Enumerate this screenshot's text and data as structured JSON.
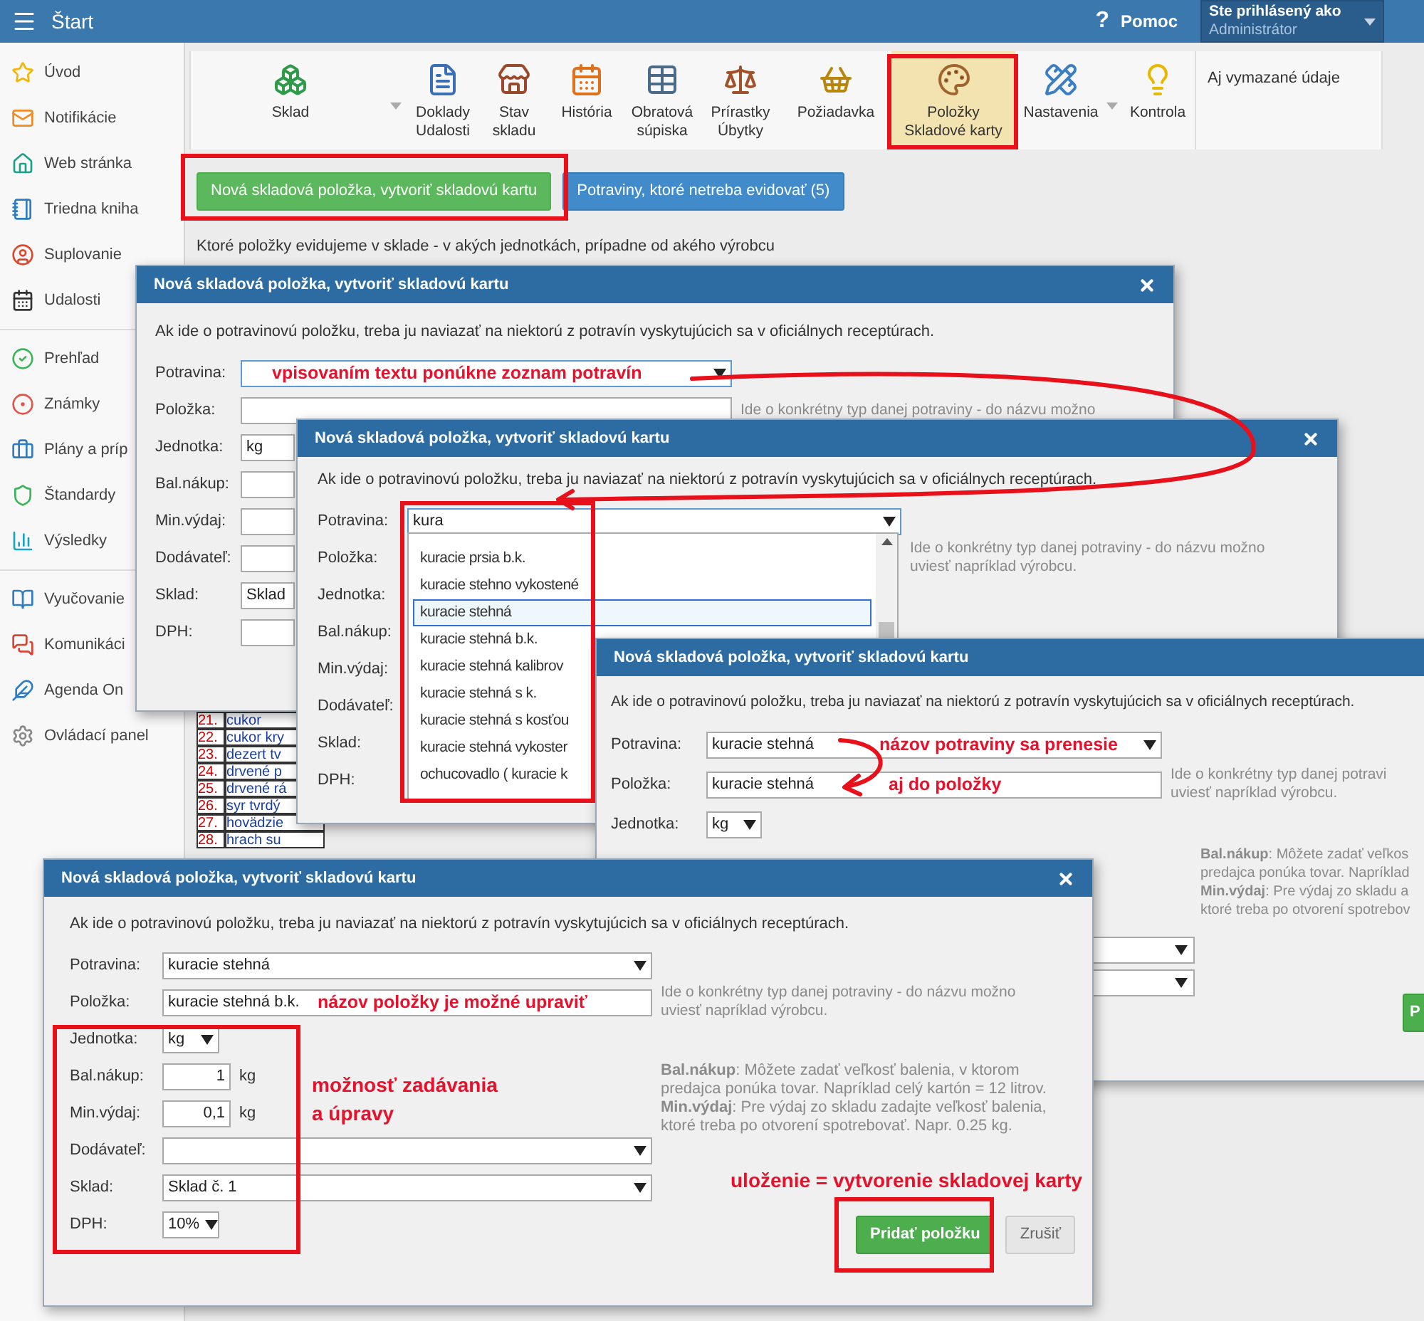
{
  "top_bar": {
    "title": "Štart",
    "help_symbol": "?",
    "help_label": "Pomoc",
    "user_caption": "Ste prihlásený ako",
    "user_name": "Administrátor"
  },
  "sidebar": {
    "sections": [
      {
        "items": [
          {
            "label": "Úvod"
          },
          {
            "label": "Notifikácie"
          },
          {
            "label": "Web stránka"
          },
          {
            "label": "Triedna kniha"
          },
          {
            "label": "Suplovanie"
          },
          {
            "label": "Udalosti"
          }
        ]
      },
      {
        "items": [
          {
            "label": "Prehľad"
          },
          {
            "label": "Známky"
          },
          {
            "label": "Plány a príp"
          },
          {
            "label": "Štandardy"
          },
          {
            "label": "Výsledky"
          }
        ]
      },
      {
        "items": [
          {
            "label": "Vyučovanie"
          },
          {
            "label": "Komunikáci"
          },
          {
            "label": "Agenda On"
          },
          {
            "label": "Ovládací panel"
          }
        ]
      }
    ]
  },
  "toolbar": {
    "items": [
      {
        "lines": [
          "Sklad"
        ],
        "menu": true,
        "selected": false
      },
      {
        "lines": [
          "Doklady",
          "Udalosti"
        ],
        "menu": false,
        "selected": false
      },
      {
        "lines": [
          "Stav",
          "skladu"
        ],
        "menu": false,
        "selected": false
      },
      {
        "lines": [
          "História"
        ],
        "menu": false,
        "selected": false
      },
      {
        "lines": [
          "Obratová",
          "súpiska"
        ],
        "menu": false,
        "selected": false
      },
      {
        "lines": [
          "Prírastky",
          "Úbytky"
        ],
        "menu": false,
        "selected": false
      },
      {
        "lines": [
          "Požiadavka"
        ],
        "menu": false,
        "selected": false
      },
      {
        "lines": [
          "Položky",
          "Skladové karty"
        ],
        "menu": false,
        "selected": true
      },
      {
        "lines": [
          "Nastavenia"
        ],
        "menu": true,
        "selected": false
      },
      {
        "lines": [
          "Kontrola"
        ],
        "menu": false,
        "selected": false
      }
    ],
    "deleted_toggle": "Aj vymazané údaje"
  },
  "actions": [
    {
      "label": "Nová skladová položka, vytvoriť skladovú kartu",
      "kind": "success"
    },
    {
      "label": "Potraviny, ktoré netreba evidovať (5)",
      "kind": "info"
    }
  ],
  "description": "Ktoré položky evidujeme v sklade - v akých jednotkách, prípadne od akého výrobcu",
  "background_list": [
    {
      "number": "21.",
      "name": "cukor"
    },
    {
      "number": "22.",
      "name": "cukor kry"
    },
    {
      "number": "23.",
      "name": "dezert tv"
    },
    {
      "number": "24.",
      "name": "drvené p"
    },
    {
      "number": "25.",
      "name": "drvené rá"
    },
    {
      "number": "26.",
      "name": "syr tvrdý"
    },
    {
      "number": "27.",
      "name": "hovädzie"
    },
    {
      "number": "28.",
      "name": "hrach su"
    }
  ],
  "dialogs": [
    {
      "title": "Nová skladová položka, vytvoriť skladovú kartu",
      "intro": "Ak ide o potravinovú položku, treba ju naviazať na niektorú z potravín vyskytujúcich sa v oficiálnych receptúrach.",
      "fields": [
        {
          "label": "Potravina:",
          "kind": "select",
          "focused": true,
          "annotation": "vpisovaním textu ponúkne zoznam potravín"
        },
        {
          "label": "Položka:",
          "kind": "input",
          "focused": false,
          "hint_lines": [
            "Ide o konkrétny typ danej potraviny - do názvu možno"
          ]
        },
        {
          "label": "Jednotka:",
          "kind": "input",
          "focused": false,
          "value": "kg"
        },
        {
          "label": "Bal.nákup:",
          "kind": "input",
          "focused": false
        },
        {
          "label": "Min.výdaj:",
          "kind": "input",
          "focused": false
        },
        {
          "label": "Dodávateľ:",
          "kind": "input",
          "focused": false
        },
        {
          "label": "Sklad:",
          "kind": "input",
          "focused": false,
          "value": "Sklad"
        },
        {
          "label": "DPH:",
          "kind": "input",
          "focused": false
        }
      ]
    },
    {
      "title": "Nová skladová položka, vytvoriť skladovú kartu",
      "intro": "Ak ide o potravinovú položku, treba ju naviazať na niektorú z potravín vyskytujúcich sa v oficiálnych receptúrach.",
      "fields": [
        {
          "label": "Potravina:",
          "kind": "select",
          "focused": true,
          "value": "kura"
        },
        {
          "label": "Položka:",
          "kind": "label",
          "hint_lines": [
            "Ide o konkrétny typ danej potraviny - do názvu možno",
            "uviesť napríklad výrobcu."
          ]
        },
        {
          "label": "Jednotka:",
          "kind": "label"
        },
        {
          "label": "Bal.nákup:",
          "kind": "label"
        },
        {
          "label": "Min.výdaj:",
          "kind": "label"
        },
        {
          "label": "Dodávateľ:",
          "kind": "label"
        },
        {
          "label": "Sklad:",
          "kind": "label"
        },
        {
          "label": "DPH:",
          "kind": "label"
        }
      ],
      "dropdown": [
        {
          "label": "kuracie prsia b.k.",
          "selected": false
        },
        {
          "label": "kuracie stehno vykostené",
          "selected": false
        },
        {
          "label": "kuracie stehná",
          "selected": true
        },
        {
          "label": "kuracie stehná b.k.",
          "selected": false
        },
        {
          "label": "kuracie stehná kalibrov",
          "selected": false
        },
        {
          "label": "kuracie stehná s k.",
          "selected": false
        },
        {
          "label": "kuracie stehná s kosťou",
          "selected": false
        },
        {
          "label": "kuracie stehná vykoster",
          "selected": false
        },
        {
          "label": "ochucovadlo ( kuracie k",
          "selected": false
        }
      ]
    },
    {
      "title": "Nová skladová položka, vytvoriť skladovú kartu",
      "intro": "Ak ide o potravinovú položku, treba ju naviazať na niektorú z potravín vyskytujúcich sa v oficiálnych receptúrach.",
      "fields": [
        {
          "label": "Potravina:",
          "kind": "select",
          "focused": false,
          "value": "kuracie stehná",
          "annotation": "názov potraviny sa prenesie"
        },
        {
          "label": "Položka:",
          "kind": "input",
          "focused": false,
          "value": "kuracie stehná",
          "annotation": "aj do položky",
          "hint_lines": [
            "Ide o konkrétny typ danej potravi",
            "uviesť napríklad výrobcu."
          ]
        },
        {
          "label": "Jednotka:",
          "kind": "small_select",
          "focused": false,
          "value": "kg"
        }
      ],
      "note_lines": [
        "**Bal.nákup**: Môžete zadať veľkos",
        "predajca ponúka tovar. Napríklad",
        "**Min.výdaj**: Pre výdaj zo skladu a",
        "ktoré treba po otvorení spotrebov"
      ],
      "buttons": [
        {
          "label": "P",
          "kind": "primary"
        }
      ]
    },
    {
      "title": "Nová skladová položka, vytvoriť skladovú kartu",
      "intro": "Ak ide o potravinovú položku, treba ju naviazať na niektorú z potravín vyskytujúcich sa v oficiálnych receptúrach.",
      "fields": [
        {
          "label": "Potravina:",
          "kind": "select",
          "focused": false,
          "value": "kuracie stehná"
        },
        {
          "label": "Položka:",
          "kind": "input",
          "focused": false,
          "value": "kuracie stehná b.k.",
          "annotation": "názov položky je možné upraviť",
          "hint_lines": [
            "Ide o konkrétny typ danej potraviny - do názvu možno",
            "uviesť napríklad výrobcu."
          ]
        },
        {
          "label": "Jednotka:",
          "kind": "small_select",
          "focused": false,
          "value": "kg"
        },
        {
          "label": "Bal.nákup:",
          "kind": "number",
          "focused": false,
          "value": "1",
          "unit": "kg"
        },
        {
          "label": "Min.výdaj:",
          "kind": "number",
          "focused": false,
          "value": "0,1",
          "unit": "kg"
        },
        {
          "label": "Dodávateľ:",
          "kind": "select",
          "focused": false
        },
        {
          "label": "Sklad:",
          "kind": "select",
          "focused": false,
          "value": "Sklad č. 1"
        },
        {
          "label": "DPH:",
          "kind": "small_select",
          "focused": false,
          "value": "10%"
        }
      ],
      "note_lines": [
        "**Bal.nákup**: Môžete zadať veľkosť balenia, v ktorom",
        "predajca ponúka tovar. Napríklad celý kartón = 12 litrov.",
        "**Min.výdaj**: Pre výdaj zo skladu zadajte veľkosť balenia,",
        "ktoré treba po otvorení spotrebovať. Napr. 0.25 kg."
      ],
      "side_annotations": [
        {
          "lines": [
            "možnosť zadávania",
            "a úpravy"
          ]
        },
        {
          "lines": [
            "uloženie = vytvorenie skladovej karty"
          ]
        }
      ],
      "buttons": [
        {
          "label": "Pridať položku",
          "kind": "primary"
        },
        {
          "label": "Zrušiť",
          "kind": "secondary"
        }
      ]
    }
  ]
}
